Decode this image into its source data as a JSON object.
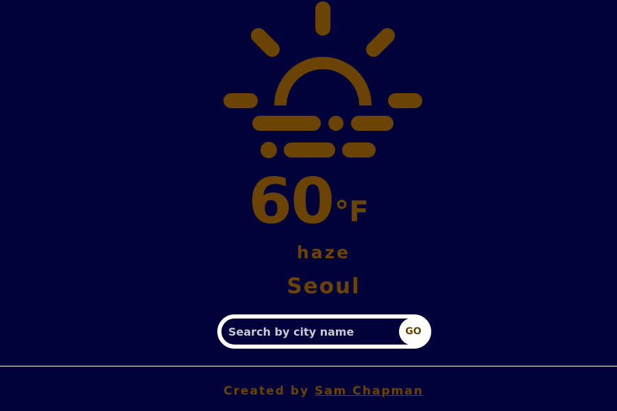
{
  "weather": {
    "icon": "sunrise-haze-icon",
    "temperature": "60",
    "unit": "°F",
    "condition": "haze",
    "city": "Seoul"
  },
  "search": {
    "placeholder": "Search by city name",
    "value": "",
    "button_label": "GO"
  },
  "footer": {
    "prefix": "Created by",
    "author": "Sam Chapman"
  },
  "colors": {
    "background": "#02023b",
    "accent": "#6b4304",
    "search_border": "#ffffff"
  }
}
